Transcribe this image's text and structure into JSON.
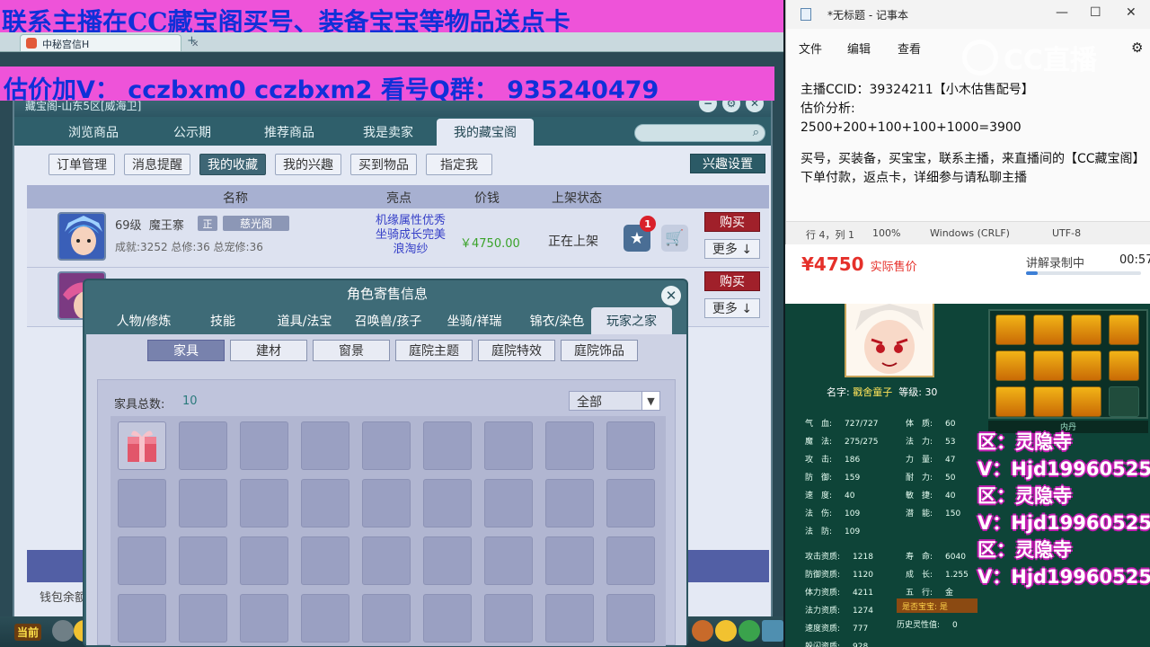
{
  "top_banner": "联系主播在CC藏宝阁买号、装备宝宝等物品送点卡",
  "second_banner": "估价加V： cczbxm0   cczbxm2   看号Q群： 935240479",
  "browser_tab": "中秘宫信H",
  "cbg": {
    "title": "藏宝阁-山东5区[威海卫]",
    "nav_tabs": [
      "浏览商品",
      "公示期",
      "推荐商品",
      "我是卖家",
      "我的藏宝阁"
    ],
    "active_nav": "我的藏宝阁",
    "sub_tabs": [
      "订单管理",
      "消息提醒",
      "我的收藏",
      "我的兴趣",
      "买到物品",
      "指定我"
    ],
    "active_sub": "我的收藏",
    "interest_settings": "兴趣设置",
    "table_headers": [
      "名称",
      "亮点",
      "价钱",
      "上架状态"
    ],
    "row1": {
      "level": "69级",
      "name": "魔王寨",
      "server_tag": "正",
      "school": "慈光阁",
      "stats": "成就:3252 总修:36 总宠修:36",
      "highlights": [
        "机缘属性优秀",
        "坐骑成长完美",
        "浪淘纱"
      ],
      "price": "￥4750.00",
      "status": "正在上架",
      "fav_badge": "1",
      "buy": "购买",
      "more": "更多 ↓"
    },
    "row2": {
      "buy": "购买",
      "more": "更多 ↓"
    },
    "wallet_label": "钱包余额",
    "taskbar_label": "当前"
  },
  "popup": {
    "title": "角色寄售信息",
    "tabs": [
      "人物/修炼",
      "技能",
      "道具/法宝",
      "召唤兽/孩子",
      "坐骑/祥瑞",
      "锦衣/染色",
      "玩家之家"
    ],
    "active_tab": "玩家之家",
    "filters": [
      "家具",
      "建材",
      "窗景",
      "庭院主题",
      "庭院特效",
      "庭院饰品"
    ],
    "active_filter": "家具",
    "furniture_total_label": "家具总数:",
    "furniture_total": "10",
    "select_value": "全部"
  },
  "notepad": {
    "title": "*无标题 - 记事本",
    "menu": [
      "文件",
      "编辑",
      "查看"
    ],
    "line1": "主播CCID：39324211【小木估售配号】",
    "line2": "估价分析:",
    "line3": "2500+200+100+100+1000=3900",
    "line4": "买号，买装备，买宝宝，联系主播，来直播间的【CC藏宝阁】下单付款，返点卡，详细参与请私聊主播",
    "status": {
      "position": "行 4，列 1",
      "zoom": "100%",
      "eol": "Windows (CRLF)",
      "encoding": "UTF-8"
    }
  },
  "cc_logo": "CC直播",
  "live": {
    "price": "¥4750",
    "price_label": "实际售价",
    "rec_label": "讲解录制中",
    "rec_time": "00:57",
    "rec_progress": 0.1
  },
  "pet": {
    "name_label": "名字:",
    "name": "戳舍童子",
    "level_label": "等级:",
    "level": "30",
    "neidan": "内丹",
    "attrs_left": [
      {
        "k": "气　血:",
        "v": "727/727"
      },
      {
        "k": "魔　法:",
        "v": "275/275"
      },
      {
        "k": "攻　击:",
        "v": "186"
      },
      {
        "k": "防　御:",
        "v": "159"
      },
      {
        "k": "速　度:",
        "v": "40"
      },
      {
        "k": "法　伤:",
        "v": "109"
      },
      {
        "k": "法　防:",
        "v": "109"
      }
    ],
    "attrs_right": [
      {
        "k": "体　质:",
        "v": "60"
      },
      {
        "k": "法　力:",
        "v": "53"
      },
      {
        "k": "力　量:",
        "v": "47"
      },
      {
        "k": "耐　力:",
        "v": "50"
      },
      {
        "k": "敏　捷:",
        "v": "40"
      },
      {
        "k": "潜　能:",
        "v": "150"
      }
    ],
    "apt_left": [
      {
        "k": "攻击资质:",
        "v": "1218"
      },
      {
        "k": "防御资质:",
        "v": "1120"
      },
      {
        "k": "体力资质:",
        "v": "4211"
      },
      {
        "k": "法力资质:",
        "v": "1274"
      },
      {
        "k": "速度资质:",
        "v": "777"
      },
      {
        "k": "躲闪资质:",
        "v": "928"
      }
    ],
    "apt_right": [
      {
        "k": "寿　命:",
        "v": "6040"
      },
      {
        "k": "成　长:",
        "v": "1.255"
      },
      {
        "k": "五　行:",
        "v": "金"
      }
    ],
    "is_baobao": "是否宝宝: 是",
    "history": {
      "k": "历史灵性值:",
      "v": "0"
    }
  },
  "region_overlay": [
    "区：灵隐寺",
    "V：Hjd19960525",
    "区：灵隐寺",
    "V：Hjd19960525",
    "区：灵隐寺",
    "V：Hjd19960525"
  ]
}
